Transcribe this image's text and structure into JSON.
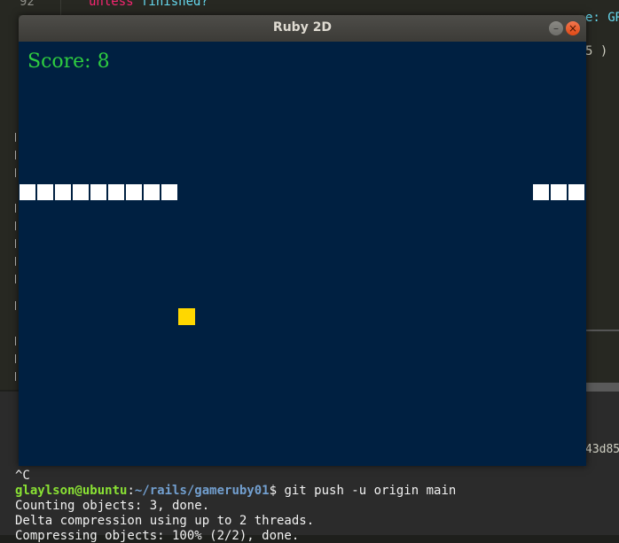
{
  "editor": {
    "line_number": "92",
    "code_keyword": "unless",
    "code_rest": " finished?",
    "right_fragment_1": "e: GR",
    "right_fragment_2": "5 )",
    "hash_fragment": "43d85"
  },
  "terminal": {
    "lines": [
      {
        "text": "^C"
      },
      {
        "user": "glaylson@ubuntu",
        "sep": ":",
        "path": "~/rails/gameruby01",
        "cmd": "$ git push -u origin main"
      },
      {
        "text": "Counting objects: 3, done."
      },
      {
        "text": "Delta compression using up to 2 threads."
      },
      {
        "text": "Compressing objects: 100% (2/2), done."
      }
    ]
  },
  "window": {
    "title": "Ruby 2D",
    "minimize_glyph": "–",
    "close_glyph": "×"
  },
  "game": {
    "score_label": "Score:",
    "score_value": "8",
    "snake_color": "#ffffff",
    "food_color": "#ffd700",
    "background_color": "#002041",
    "score_color": "#2ecc40"
  }
}
